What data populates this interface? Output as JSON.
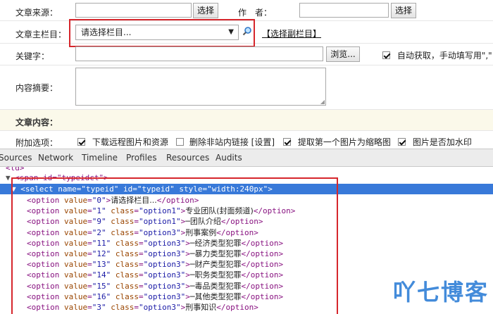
{
  "form": {
    "source_label": "文章来源：",
    "source_button": "选择",
    "author_label": "作　者：",
    "author_button": "选择",
    "main_column_label": "文章主栏目：",
    "main_column_selected": "请选择栏目...",
    "sub_column_link": "【选择副栏目】",
    "keywords_label": "关键字：",
    "keywords_browse": "浏览...",
    "auto_fetch_text": "自动获取，手动填写用\",\"",
    "summary_label": "内容摘要：",
    "content_label": "文章内容：",
    "extra_label": "附加选项：",
    "opt_download_remote": "下载远程图片和资源",
    "opt_remove_links": "删除非站内链接",
    "opt_settings": "[设置]",
    "opt_first_image": "提取第一个图片为缩略图",
    "opt_watermark": "图片是否加水印"
  },
  "devtools": {
    "tabs": [
      "Sources",
      "Network",
      "Timeline",
      "Profiles",
      "Resources",
      "Audits"
    ]
  },
  "code": {
    "partial_line_1": "<td>",
    "partial_line_2": "<span id=\"typeidct\">",
    "select_open": "<select name=\"typeid\" id=\"typeid\" style=\"width:240px\">",
    "options": [
      {
        "value": "0",
        "class": "",
        "text": "请选择栏目..."
      },
      {
        "value": "1",
        "class": "option1",
        "text": "专业团队(封面频道)"
      },
      {
        "value": "9",
        "class": "option1",
        "text": "─团队介绍"
      },
      {
        "value": "2",
        "class": "option3",
        "text": "刑事案例"
      },
      {
        "value": "11",
        "class": "option3",
        "text": "─经济类型犯罪"
      },
      {
        "value": "12",
        "class": "option3",
        "text": "─暴力类型犯罪"
      },
      {
        "value": "13",
        "class": "option3",
        "text": "─财产类型犯罪"
      },
      {
        "value": "14",
        "class": "option3",
        "text": "─职务类型犯罪"
      },
      {
        "value": "15",
        "class": "option3",
        "text": "─毒品类型犯罪"
      },
      {
        "value": "16",
        "class": "option3",
        "text": "─其他类型犯罪"
      },
      {
        "value": "3",
        "class": "option3",
        "text": "刑事知识"
      }
    ]
  },
  "watermark": "吖七博客",
  "colors": {
    "highlight": "#3879d9",
    "red_box": "#d6262c",
    "watermark": "#2f7fd6"
  }
}
